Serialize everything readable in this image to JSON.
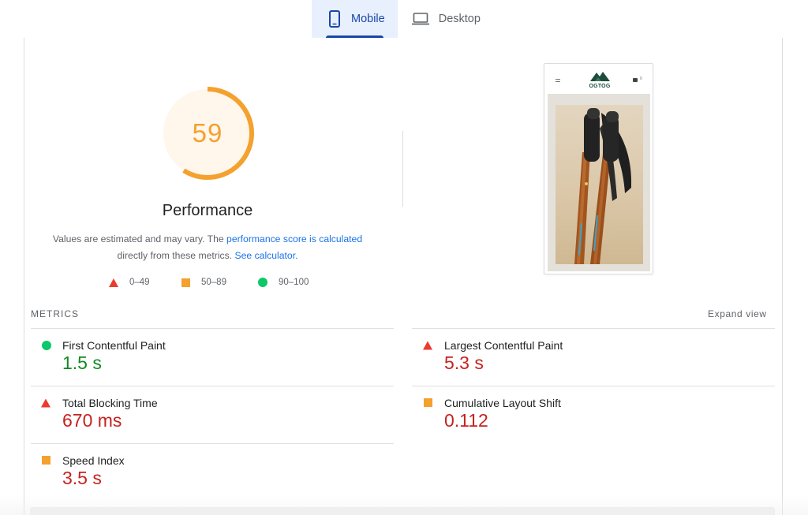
{
  "tabs": [
    {
      "label": "Mobile",
      "icon": "smartphone-icon",
      "active": true
    },
    {
      "label": "Desktop",
      "icon": "laptop-icon",
      "active": false
    }
  ],
  "score": {
    "value": "59",
    "fraction": 0.59,
    "label": "Performance",
    "color": "#f4a12d",
    "track_bg": "#fff6ec"
  },
  "description": {
    "text1": "Values are estimated and may vary. The ",
    "link1": "performance score is calculated",
    "text2": "directly from these metrics. ",
    "link2": "See calculator."
  },
  "legend": [
    {
      "shape": "triangle",
      "color": "#eb3b2e",
      "range": "0–49"
    },
    {
      "shape": "square",
      "color": "#f4a12d",
      "range": "50–89"
    },
    {
      "shape": "circle",
      "color": "#0cc86a",
      "range": "90–100"
    }
  ],
  "screenshot": {
    "brand": "OGTOG"
  },
  "metrics": {
    "heading": "METRICS",
    "expand_label": "Expand view",
    "items": [
      {
        "name": "First Contentful Paint",
        "value": "1.5 s",
        "status": "pass",
        "shape": "circle",
        "color": "#0cc86a",
        "value_color": "#118a23"
      },
      {
        "name": "Largest Contentful Paint",
        "value": "5.3 s",
        "status": "fail",
        "shape": "triangle",
        "color": "#eb3b2e",
        "value_color": "#c5221f"
      },
      {
        "name": "Total Blocking Time",
        "value": "670 ms",
        "status": "fail",
        "shape": "triangle",
        "color": "#eb3b2e",
        "value_color": "#c5221f"
      },
      {
        "name": "Cumulative Layout Shift",
        "value": "0.112",
        "status": "average",
        "shape": "square",
        "color": "#f4a12d",
        "value_color": "#c5221f"
      },
      {
        "name": "Speed Index",
        "value": "3.5 s",
        "status": "average",
        "shape": "square",
        "color": "#f4a12d",
        "value_color": "#c5221f"
      }
    ]
  }
}
